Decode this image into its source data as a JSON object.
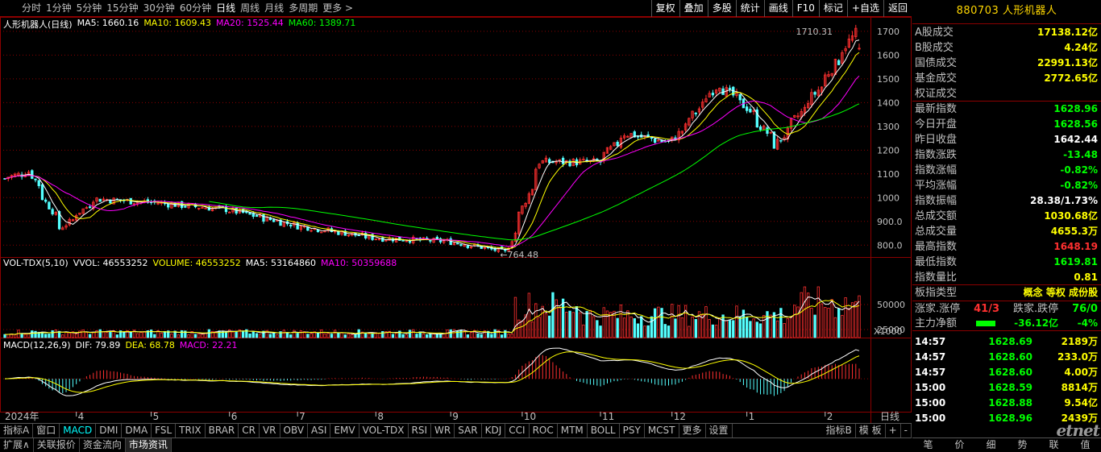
{
  "toolbar": {
    "periods": [
      "分时",
      "1分钟",
      "5分钟",
      "15分钟",
      "30分钟",
      "60分钟",
      "日线",
      "周线",
      "月线",
      "多周期",
      "更多 >"
    ],
    "active_period": "日线",
    "right_buttons": [
      "复权",
      "叠加",
      "多股",
      "统计",
      "画线",
      "F10",
      "标记",
      "+自选",
      "返回"
    ]
  },
  "stock": {
    "code": "880703",
    "name": "人形机器人",
    "title": "880703 人形机器人"
  },
  "price_head": {
    "name": "人形机器人(日线)",
    "ma5": "MA5: 1660.16",
    "ma10": "MA10: 1609.43",
    "ma20": "MA20: 1525.44",
    "ma60": "MA60: 1389.71"
  },
  "vol_head": {
    "name": "VOL-TDX(5,10)",
    "vvol": "VVOL: 46553252",
    "volume": "VOLUME: 46553252",
    "ma5": "MA5: 53164860",
    "ma10": "MA10: 50359688"
  },
  "macd_head": {
    "name": "MACD(12,26,9)",
    "dif": "DIF: 79.89",
    "dea": "DEA: 68.78",
    "macd": "MACD: 22.21"
  },
  "price_axis": [
    "1700",
    "1600",
    "1500",
    "1400",
    "1300",
    "1200",
    "1100",
    "1000",
    "900.0",
    "800.0"
  ],
  "vol_axis": [
    "50000",
    "25000"
  ],
  "vol_unit": "X1000",
  "annotations": {
    "high": "1710.31",
    "low": "764.48"
  },
  "months": [
    "2024年",
    "4",
    "5",
    "6",
    "7",
    "8",
    "9",
    "10",
    "11",
    "12",
    "1",
    "2"
  ],
  "period_label": "日线",
  "right_panel": {
    "rows": [
      {
        "label": "A股成交",
        "value": "17138.12亿",
        "color": "#ffff00"
      },
      {
        "label": "B股成交",
        "value": "4.24亿",
        "color": "#ffff00"
      },
      {
        "label": "国债成交",
        "value": "22991.13亿",
        "color": "#ffff00"
      },
      {
        "label": "基金成交",
        "value": "2772.65亿",
        "color": "#ffff00"
      },
      {
        "label": "权证成交",
        "value": "",
        "color": "#ffff00"
      },
      {
        "label": "最新指数",
        "value": "1628.96",
        "color": "#00ff00"
      },
      {
        "label": "今日开盘",
        "value": "1628.56",
        "color": "#00ff00"
      },
      {
        "label": "昨日收盘",
        "value": "1642.44",
        "color": "#ffffff"
      },
      {
        "label": "指数涨跌",
        "value": "-13.48",
        "color": "#00ff00"
      },
      {
        "label": "指数涨幅",
        "value": "-0.82%",
        "color": "#00ff00"
      },
      {
        "label": "平均涨幅",
        "value": "-0.82%",
        "color": "#00ff00"
      },
      {
        "label": "指数振幅",
        "value": "28.38/1.73%",
        "color": "#ffffff"
      },
      {
        "label": "总成交额",
        "value": "1030.68亿",
        "color": "#ffff00"
      },
      {
        "label": "总成交量",
        "value": "4655.3万",
        "color": "#ffff00"
      },
      {
        "label": "最高指数",
        "value": "1648.19",
        "color": "#ff3030"
      },
      {
        "label": "最低指数",
        "value": "1619.81",
        "color": "#00ff00"
      },
      {
        "label": "指数量比",
        "value": "0.81",
        "color": "#ffff00"
      },
      {
        "label": "板指类型",
        "value": "概念 等权 成份股",
        "color": "#ffff00"
      }
    ],
    "rise_label": "涨家.涨停",
    "rise_value": "41/3",
    "fall_label": "跌家.跌停",
    "fall_value": "76/0",
    "net_label": "主力净额",
    "net_value": "-36.12亿",
    "net_pct": "-4%",
    "ticks": [
      {
        "time": "14:57",
        "price": "1628.69",
        "vol": "2189万"
      },
      {
        "time": "14:57",
        "price": "1628.60",
        "vol": "233.0万"
      },
      {
        "time": "14:57",
        "price": "1628.60",
        "vol": "4.00万"
      },
      {
        "time": "15:00",
        "price": "1628.59",
        "vol": "8814万"
      },
      {
        "time": "15:00",
        "price": "1628.88",
        "vol": "9.54亿"
      },
      {
        "time": "15:00",
        "price": "1628.96",
        "vol": "2439万"
      }
    ],
    "bottom_tabs": [
      "笔",
      "价",
      "细",
      "势",
      "联",
      "值"
    ]
  },
  "indicator_tabs": [
    "指标A",
    "窗口",
    "MACD",
    "DMI",
    "DMA",
    "FSL",
    "TRIX",
    "BRAR",
    "CR",
    "VR",
    "OBV",
    "ASI",
    "EMV",
    "VOL-TDX",
    "RSI",
    "WR",
    "SAR",
    "KDJ",
    "CCI",
    "ROC",
    "MTM",
    "BOLL",
    "PSY",
    "MCST",
    "更多",
    "设置"
  ],
  "indicator_right": [
    "指标B",
    "模 板",
    "+",
    "-"
  ],
  "status_tabs": [
    "扩展∧",
    "关联报价",
    "资金流向",
    "市场资讯"
  ],
  "logo": "etnet",
  "colors": {
    "up": "#ff3030",
    "down": "#54ffff",
    "ma5": "#ffffff",
    "ma10": "#ffff00",
    "ma20": "#ff00ff",
    "ma60": "#00ff00",
    "grid": "#8b0000"
  },
  "chart_data": {
    "type": "candlestick",
    "ylim": [
      750,
      1720
    ],
    "close_keypoints": [
      {
        "date": "2024-03-01",
        "close": 1080
      },
      {
        "date": "2024-03-12",
        "close": 1110
      },
      {
        "date": "2024-03-25",
        "close": 870
      },
      {
        "date": "2024-04-08",
        "close": 995
      },
      {
        "date": "2024-05-01",
        "close": 980
      },
      {
        "date": "2024-06-01",
        "close": 950
      },
      {
        "date": "2024-07-01",
        "close": 880
      },
      {
        "date": "2024-08-01",
        "close": 830
      },
      {
        "date": "2024-09-01",
        "close": 815
      },
      {
        "date": "2024-09-24",
        "close": 770
      },
      {
        "date": "2024-10-08",
        "close": 1150
      },
      {
        "date": "2024-11-01",
        "close": 1150
      },
      {
        "date": "2024-11-12",
        "close": 1270
      },
      {
        "date": "2024-12-01",
        "close": 1230
      },
      {
        "date": "2024-12-20",
        "close": 1480
      },
      {
        "date": "2025-01-01",
        "close": 1380
      },
      {
        "date": "2025-01-13",
        "close": 1220
      },
      {
        "date": "2025-02-01",
        "close": 1480
      },
      {
        "date": "2025-02-14",
        "close": 1690
      },
      {
        "date": "2025-02-17",
        "close": 1629
      }
    ],
    "macd_ylim": [
      -100,
      120
    ]
  }
}
